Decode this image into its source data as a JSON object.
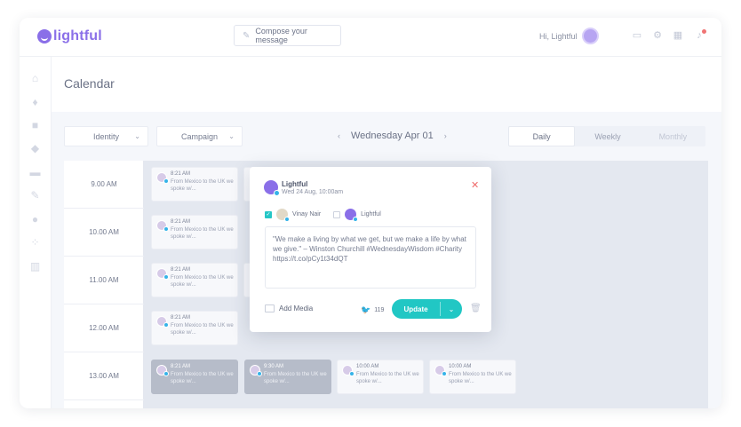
{
  "brand": {
    "name": "lightful",
    "accent": "#8a6fe8"
  },
  "header": {
    "compose_label": "Compose your message",
    "greeting": "Hi, Lightful",
    "icons": [
      "chat-icon",
      "gear-icon",
      "calendar-icon",
      "bell-icon"
    ]
  },
  "sidebar": {
    "icons": [
      "home-icon",
      "thumbs-up-icon",
      "inbox-icon",
      "layers-icon",
      "window-icon",
      "pen-icon",
      "target-icon",
      "people-icon",
      "bar-chart-icon"
    ]
  },
  "page": {
    "title": "Calendar"
  },
  "filters": {
    "identity": "Identity",
    "campaign": "Campaign"
  },
  "date_nav": {
    "prev": "‹",
    "date": "Wednesday Apr 01",
    "next": "›"
  },
  "views": {
    "daily": "Daily",
    "weekly": "Weekly",
    "monthly": "Monthly"
  },
  "times": [
    "9.00 AM",
    "10.00 AM",
    "11.00 AM",
    "12.00 AM",
    "13.00 AM"
  ],
  "cards": [
    {
      "time": "8:21 AM",
      "text": "From Mexico to the UK we spoke w/..."
    },
    {
      "time": "8:21 AM",
      "text": "From Mexico to the UK we spoke w/..."
    },
    {
      "time": "8:21 AM",
      "text": "From Mexico to the UK we spoke w/..."
    },
    {
      "time": "8:21 AM",
      "text": "From Mexico to the UK we spoke w/..."
    },
    {
      "time": "8:21 AM",
      "text": "From Mexico to the UK we spoke w/..."
    },
    {
      "time": "9:30 AM",
      "text": "From Mexico to the UK we spoke w/..."
    },
    {
      "time": "10:00 AM",
      "text": "From Mexico to the UK we spoke w/..."
    },
    {
      "time": "10:00 AM",
      "text": "From Mexico to the UK we spoke w/..."
    }
  ],
  "popup": {
    "name": "Lightful",
    "date": "Wed 24 Aug, 10:00am",
    "accounts": [
      {
        "name": "Vinay Nair",
        "checked": true
      },
      {
        "name": "Lightful",
        "checked": false
      }
    ],
    "message": "\"We make a living by what we get, but we make a life by what we give.\" – Winston Churchill #WednesdayWisdom #Charity https://t.co/pCy1t34dQT",
    "add_media": "Add Media",
    "char_count": "119",
    "update_label": "Update"
  },
  "colors": {
    "primary_button": "#21c7c4",
    "close": "#ef6b6b",
    "twitter": "#35b3e8"
  }
}
